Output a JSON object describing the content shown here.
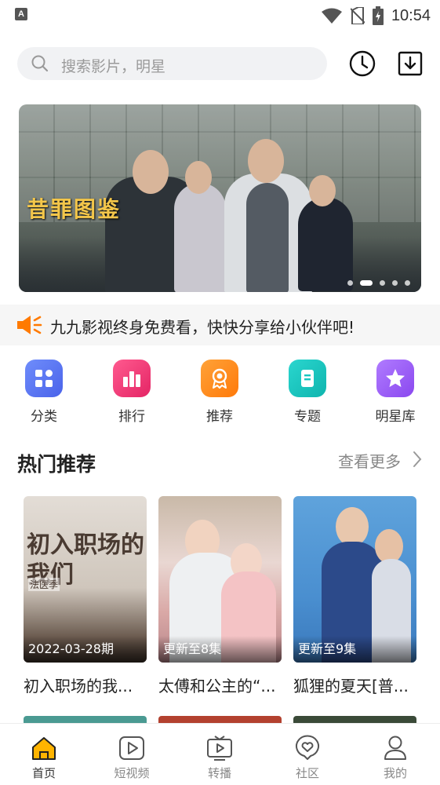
{
  "status_bar": {
    "time": "10:54",
    "notification_badge": "A"
  },
  "search": {
    "placeholder": "搜索影片，明星"
  },
  "header": {
    "icons": [
      "history-clock-icon",
      "download-icon"
    ]
  },
  "banner": {
    "title_art": "昔罪图鉴",
    "slide_count": 5,
    "active_slide": 2
  },
  "notice": {
    "text": "九九影视终身免费看，快快分享给小伙伴吧!"
  },
  "categories": [
    {
      "label": "分类",
      "icon": "grid-icon",
      "color": "#5b7cf7"
    },
    {
      "label": "排行",
      "icon": "ranking-icon",
      "color": "#f0427a"
    },
    {
      "label": "推荐",
      "icon": "award-icon",
      "color": "#ff8a1f"
    },
    {
      "label": "专题",
      "icon": "topic-icon",
      "color": "#16c7c1"
    },
    {
      "label": "明星库",
      "icon": "star-icon",
      "color": "#9a5cf5"
    }
  ],
  "section": {
    "title": "热门推荐",
    "more_label": "查看更多"
  },
  "cards": [
    {
      "title": "初入职场的我...",
      "tag": "2022-03-28期",
      "poster_text": "初入职场的我们",
      "poster_sub": "法医季"
    },
    {
      "title": "太傅和公主的“...",
      "tag": "更新至8集"
    },
    {
      "title": "狐狸的夏天[普...",
      "tag": "更新至9集"
    }
  ],
  "tabs": [
    {
      "label": "首页",
      "icon": "home-icon",
      "active": true
    },
    {
      "label": "短视频",
      "icon": "play-icon",
      "active": false
    },
    {
      "label": "转播",
      "icon": "broadcast-icon",
      "active": false
    },
    {
      "label": "社区",
      "icon": "heart-chat-icon",
      "active": false
    },
    {
      "label": "我的",
      "icon": "user-icon",
      "active": false
    }
  ]
}
